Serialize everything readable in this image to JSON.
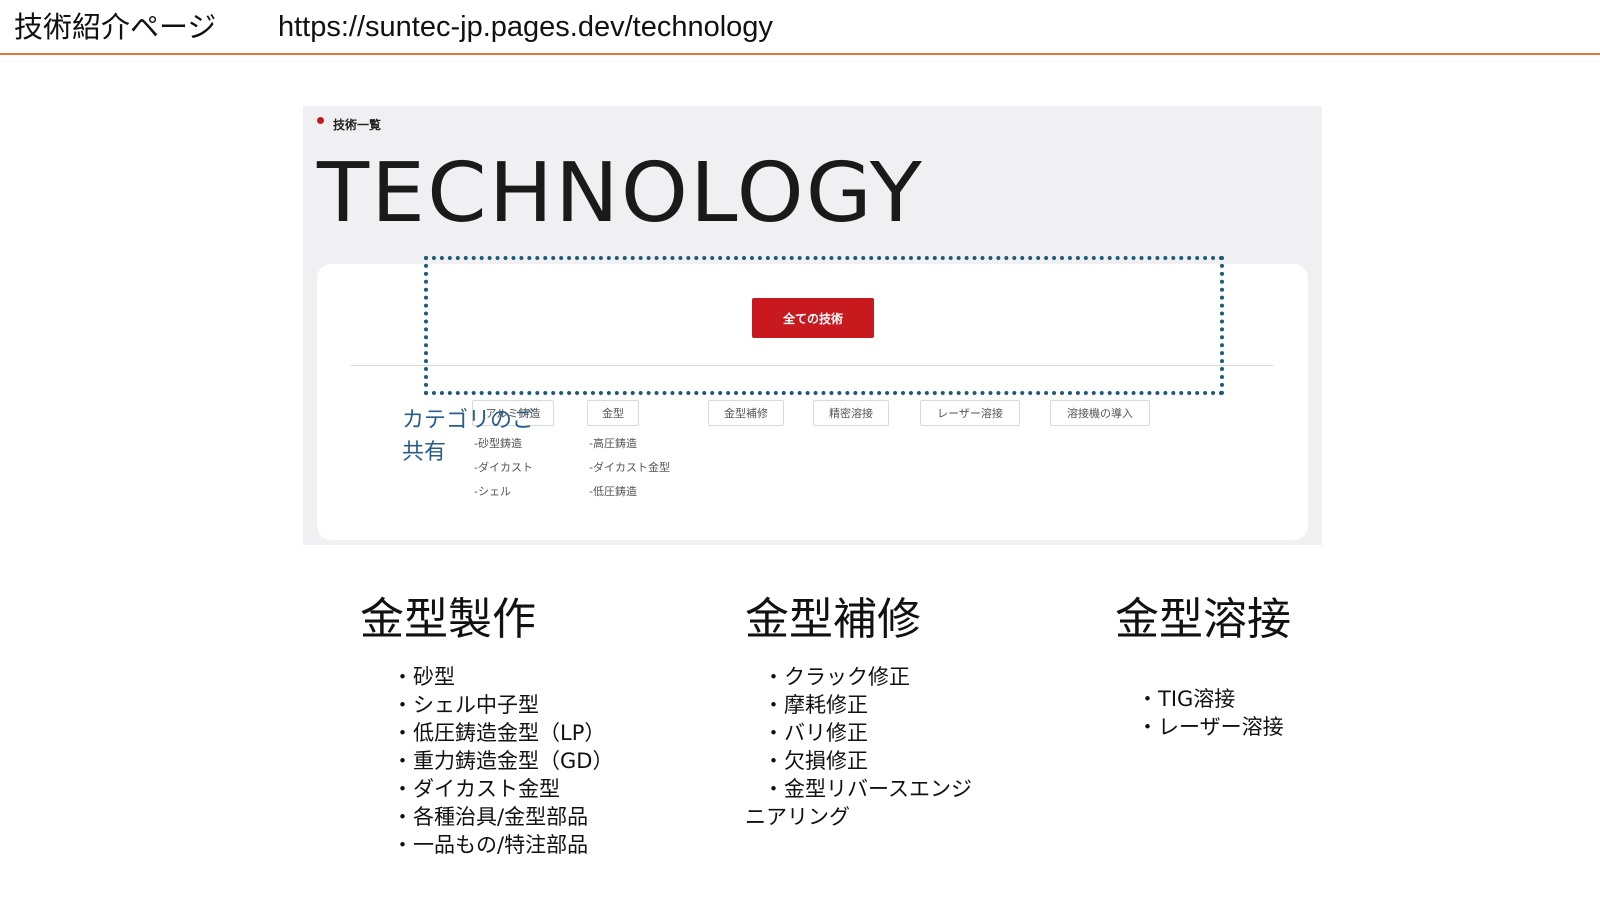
{
  "slide": {
    "title": "技術紹介ページ",
    "url": "https://suntec-jp.pages.dev/technology"
  },
  "screenshot": {
    "breadcrumb": "技術一覧",
    "hero_title": "TECHNOLOGY",
    "all_button": "全ての技術",
    "categories": [
      {
        "label": "アルミ鋳造",
        "subitems": [
          "-砂型鋳造",
          "-ダイカスト",
          "-シェル"
        ]
      },
      {
        "label": "金型",
        "subitems": [
          "-高圧鋳造",
          "-ダイカスト金型",
          "-低圧鋳造"
        ]
      },
      {
        "label": "金型補修",
        "subitems": []
      },
      {
        "label": "精密溶接",
        "subitems": []
      },
      {
        "label": "レーザー溶接",
        "subitems": []
      },
      {
        "label": "溶接機の導入",
        "subitems": []
      }
    ]
  },
  "annotation": {
    "line1": "カテゴリのご",
    "line2": "共有"
  },
  "columns": [
    {
      "heading": "金型製作",
      "items": [
        "・砂型",
        "・シェル中子型",
        "・低圧鋳造金型（LP）",
        "・重力鋳造金型（GD）",
        "・ダイカスト金型",
        "・各種治具/金型部品",
        "・一品もの/特注部品"
      ]
    },
    {
      "heading": "金型補修",
      "items": [
        "・クラック修正",
        "・摩耗修正",
        "・バリ修正",
        "・欠損修正",
        "・金型リバースエンジ",
        "ニアリング"
      ]
    },
    {
      "heading": "金型溶接",
      "items": [
        "・TIG溶接",
        "・レーザー溶接"
      ]
    }
  ],
  "colors": {
    "accent_red": "#c8191f",
    "header_rule": "#e07b3c",
    "annotation_blue": "#2a5d8a",
    "dotted_border": "#1f5a78"
  }
}
